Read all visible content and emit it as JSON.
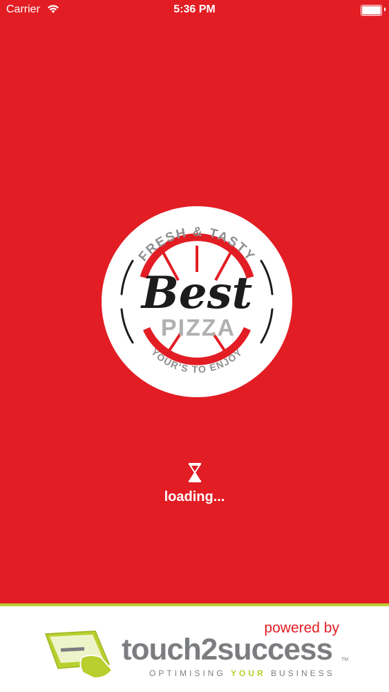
{
  "status_bar": {
    "carrier": "Carrier",
    "time": "5:36 PM",
    "icons": [
      "wifi-icon",
      "battery-icon"
    ]
  },
  "logo": {
    "top_text": "FRESH & TASTY",
    "brand_script": "Best",
    "brand_word": "PIZZA",
    "bottom_text": "YOUR'S TO ENJOY"
  },
  "loading": {
    "icon": "hourglass-icon",
    "text": "loading..."
  },
  "footer": {
    "powered_by": "powered by",
    "brand": "touch2success",
    "trademark": "TM",
    "tagline_pre": "OPTIMISING ",
    "tagline_highlight": "YOUR",
    "tagline_post": " BUSINESS",
    "icon": "touchscreen-hand-icon"
  },
  "colors": {
    "background": "#e21d24",
    "accent_green": "#b8cf2e",
    "gray_text": "#7b7d80"
  }
}
